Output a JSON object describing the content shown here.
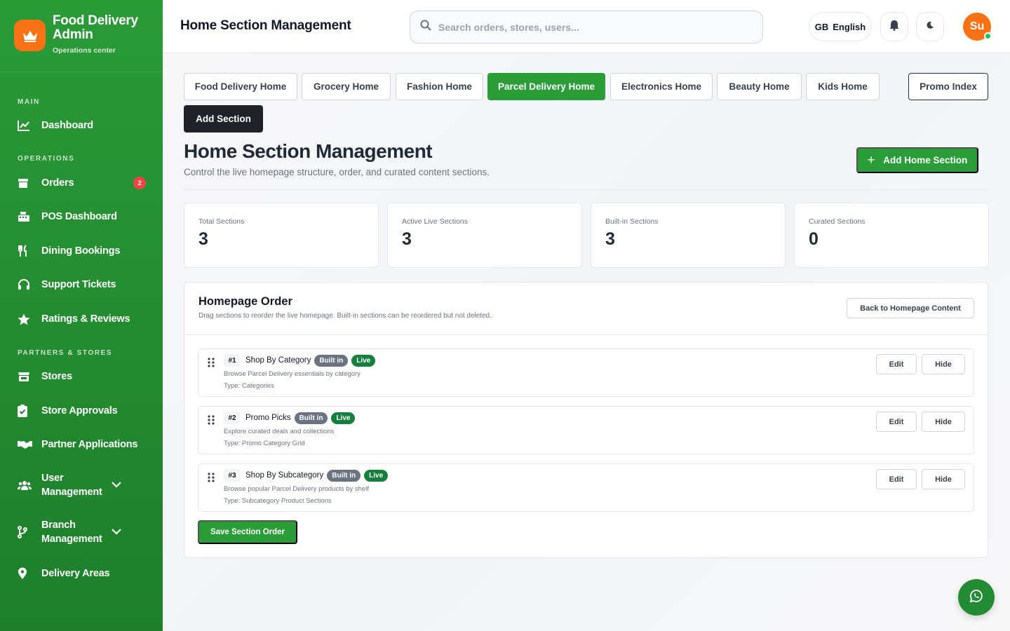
{
  "brand": {
    "title": "Food Delivery Admin",
    "subtitle": "Operations center"
  },
  "sidebar": {
    "sections": {
      "main": "MAIN",
      "operations": "OPERATIONS",
      "partners": "PARTNERS & STORES"
    },
    "items": {
      "dashboard": "Dashboard",
      "orders": "Orders",
      "orders_badge": "2",
      "pos": "POS Dashboard",
      "dining": "Dining Bookings",
      "support": "Support Tickets",
      "ratings": "Ratings & Reviews",
      "stores": "Stores",
      "approvals": "Store Approvals",
      "partner_apps": "Partner Applications",
      "user_mgmt": "User Management",
      "branch_mgmt": "Branch Management",
      "delivery_areas": "Delivery Areas"
    }
  },
  "header": {
    "title": "Home Section Management",
    "search_placeholder": "Search orders, stores, users...",
    "lang_flag": "GB",
    "lang_label": "English",
    "avatar": "Su"
  },
  "tabs": [
    "Food Delivery Home",
    "Grocery Home",
    "Fashion Home",
    "Parcel Delivery Home",
    "Electronics Home",
    "Beauty Home",
    "Kids Home"
  ],
  "active_tab": "Parcel Delivery Home",
  "promo_index": "Promo Index",
  "add_section": "Add Section",
  "page": {
    "title": "Home Section Management",
    "subtitle": "Control the live homepage structure, order, and curated content sections.",
    "add_home_section": "Add Home Section"
  },
  "stats": [
    {
      "label": "Total Sections",
      "value": "3"
    },
    {
      "label": "Active Live Sections",
      "value": "3"
    },
    {
      "label": "Built-in Sections",
      "value": "3"
    },
    {
      "label": "Curated Sections",
      "value": "0"
    }
  ],
  "panel": {
    "title": "Homepage Order",
    "subtitle": "Drag sections to reorder the live homepage. Built-in sections can be reordered but not deleted.",
    "back_button": "Back to Homepage Content",
    "save_button": "Save Section Order",
    "rows": [
      {
        "num": "#1",
        "name": "Shop By Category",
        "built": "Built in",
        "status": "Live",
        "desc": "Browse Parcel Delivery essentials by category",
        "type": "Type: Categories",
        "edit": "Edit",
        "hide": "Hide"
      },
      {
        "num": "#2",
        "name": "Promo Picks",
        "built": "Built in",
        "status": "Live",
        "desc": "Explore curated deals and collections",
        "type": "Type: Promo Category Grid",
        "edit": "Edit",
        "hide": "Hide"
      },
      {
        "num": "#3",
        "name": "Shop By Subcategory",
        "built": "Built in",
        "status": "Live",
        "desc": "Browse popular Parcel Delivery products by shelf",
        "type": "Type: Subcategory Product Sections",
        "edit": "Edit",
        "hide": "Hide"
      }
    ]
  },
  "colors": {
    "primary_green": "#2a9d39",
    "sidebar_green": "#1d7f2a",
    "accent_orange": "#f97316",
    "live_green": "#15803d"
  }
}
